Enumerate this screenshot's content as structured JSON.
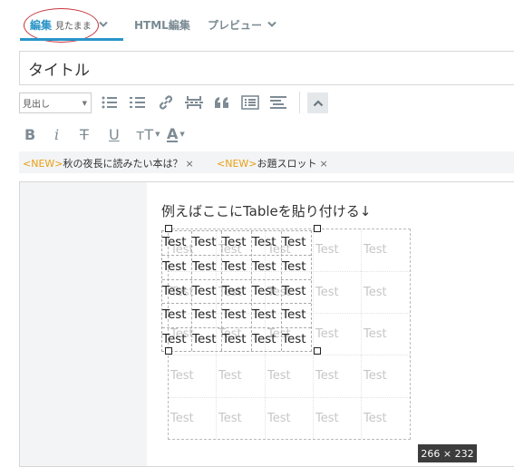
{
  "tabs": {
    "edit_label": "編集",
    "edit_sub": "見たまま",
    "html_label": "HTML編集",
    "preview_label": "プレビュー"
  },
  "title": {
    "value": "タイトル",
    "placeholder": "タイトル"
  },
  "toolbar": {
    "heading_select": "見出し",
    "buttons": [
      "bullet-list-icon",
      "numbered-list-icon",
      "link-icon",
      "page-break-icon",
      "quote-icon",
      "table-of-contents-icon",
      "align-icon",
      "collapse-icon"
    ],
    "format": [
      "B",
      "i",
      "T",
      "U",
      "тT",
      "A"
    ]
  },
  "tags": [
    {
      "new": "<NEW>",
      "text": "秋の夜長に読みたい本は？",
      "close": "×"
    },
    {
      "new": "<NEW>",
      "text": "お題スロット",
      "close": "×"
    }
  ],
  "editor": {
    "text": "例えばここにTableを貼り付ける↓",
    "cell_text": "Test",
    "size_badge": "266 × 232"
  },
  "colors": {
    "accent": "#2a95c9",
    "new_tag": "#e8a015",
    "annotation": "#c8323a"
  }
}
